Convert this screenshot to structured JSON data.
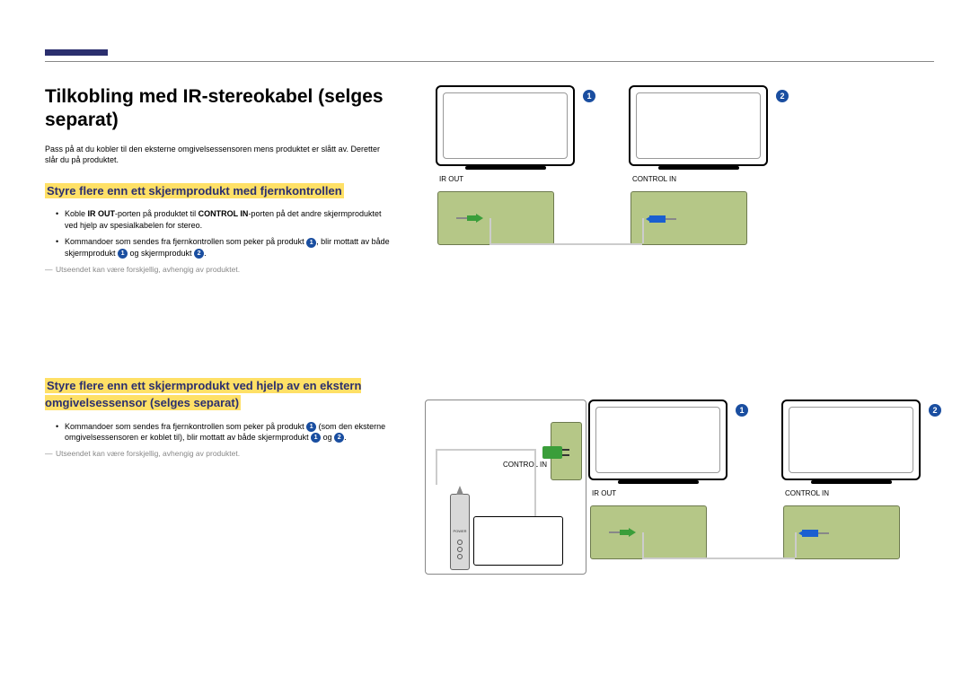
{
  "title": "Tilkobling med IR-stereokabel (selges separat)",
  "intro": "Pass på at du kobler til den eksterne omgivelsessensoren mens produktet er slått av. Deretter slår du på produktet.",
  "section1": {
    "heading": "Styre flere enn ett skjermprodukt med fjernkontrollen",
    "bullet1_pre": "Koble ",
    "bullet1_b1": "IR OUT",
    "bullet1_mid": "-porten på produktet til ",
    "bullet1_b2": "CONTROL IN",
    "bullet1_post": "-porten på det andre skjermproduktet ved hjelp av spesialkabelen for stereo.",
    "bullet2_pre": "Kommandoer som sendes fra fjernkontrollen som peker på produkt ",
    "bullet2_mid": ", blir mottatt av både skjermprodukt ",
    "bullet2_and": " og skjermprodukt ",
    "bullet2_end": ".",
    "note": "Utseendet kan være forskjellig, avhengig av produktet."
  },
  "section2": {
    "heading": "Styre flere enn ett skjermprodukt ved hjelp av en ekstern omgivelsessensor (selges separat)",
    "bullet1_pre": "Kommandoer som sendes fra fjernkontrollen som peker på produkt ",
    "bullet1_mid": " (som den eksterne omgivelsessensoren er koblet til), blir mottatt av både skjermprodukt ",
    "bullet1_and": " og ",
    "bullet1_end": ".",
    "note": "Utseendet kan være forskjellig, avhengig av produktet."
  },
  "labels": {
    "num1": "1",
    "num2": "2",
    "ir_out": "IR OUT",
    "control_in": "CONTROL IN",
    "power": "POWER"
  }
}
